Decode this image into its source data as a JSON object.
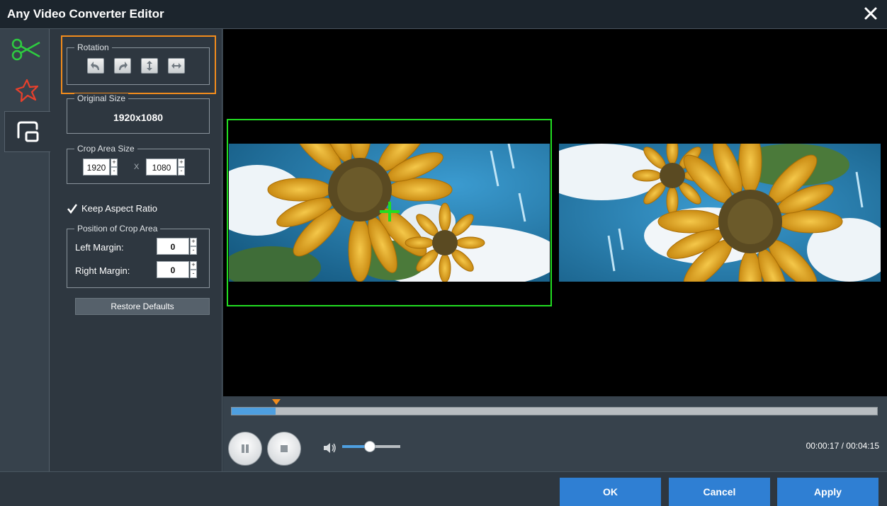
{
  "window": {
    "title": "Any Video Converter Editor"
  },
  "tabs": [
    {
      "name": "trim",
      "icon": "scissors-icon",
      "color": "#2ecc40"
    },
    {
      "name": "effects",
      "icon": "star-burst-icon",
      "color": "#e8402c"
    },
    {
      "name": "crop",
      "icon": "crop-icon",
      "color": "#ffffff"
    }
  ],
  "rotation": {
    "legend": "Rotation",
    "buttons": [
      "rotate-left-icon",
      "rotate-right-icon",
      "flip-vertical-icon",
      "flip-horizontal-icon"
    ]
  },
  "original_size": {
    "legend": "Original Size",
    "value": "1920x1080"
  },
  "crop_area_size": {
    "legend": "Crop Area Size",
    "width": "1920",
    "separator": "X",
    "height": "1080"
  },
  "keep_aspect_ratio": {
    "label": "Keep Aspect Ratio",
    "checked": true
  },
  "position": {
    "legend": "Position of Crop Area",
    "left_label": "Left Margin:",
    "left_value": "0",
    "right_label": "Right Margin:",
    "right_value": "0"
  },
  "restore_label": "Restore Defaults",
  "playback": {
    "progress_fraction": 0.068,
    "volume_fraction": 0.47,
    "time": "00:00:17 / 00:04:15"
  },
  "footer": {
    "ok_label": "OK",
    "cancel_label": "Cancel",
    "apply_label": "Apply"
  },
  "colors": {
    "accent_blue": "#2f7fd3",
    "crop_green": "#22dd22",
    "highlight_orange": "#f28c1c"
  }
}
